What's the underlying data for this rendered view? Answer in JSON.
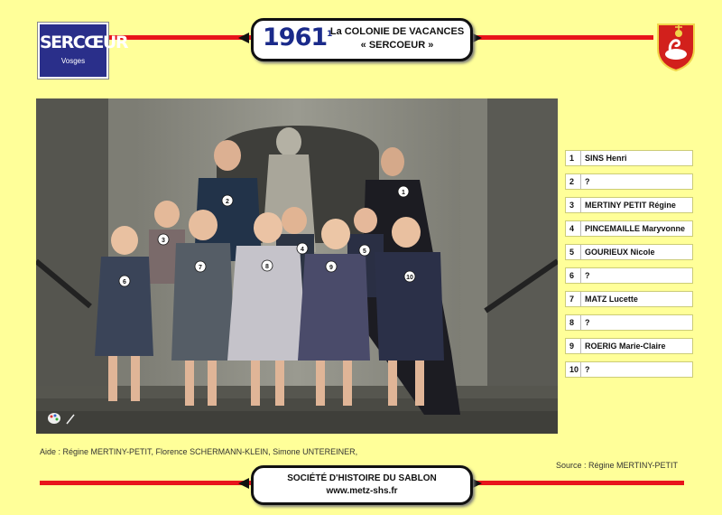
{
  "header": {
    "logo_text": "SERCŒUR",
    "logo_subtext": "Vosges",
    "year": "1961",
    "year_sup": "1",
    "title_line1": "La COLONIE DE VACANCES",
    "title_line2": "« SERCOEUR »"
  },
  "names": [
    {
      "num": "1",
      "name": "SINS Henri"
    },
    {
      "num": "2",
      "name": "?"
    },
    {
      "num": "3",
      "name": "MERTINY PETIT Régine"
    },
    {
      "num": "4",
      "name": "PINCEMAILLE Maryvonne"
    },
    {
      "num": "5",
      "name": "GOURIEUX Nicole"
    },
    {
      "num": "6",
      "name": "?"
    },
    {
      "num": "7",
      "name": "MATZ Lucette"
    },
    {
      "num": "8",
      "name": "?"
    },
    {
      "num": "9",
      "name": "ROERIG Marie-Claire"
    },
    {
      "num": "10",
      "name": "?"
    }
  ],
  "footer": {
    "aide": "Aide : Régine MERTINY-PETIT, Florence SCHERMANN-KLEIN, Simone UNTEREINER,",
    "source": "Source : Régine MERTINY-PETIT",
    "society": "SOCIÉTÉ D'HISTOIRE DU SABLON",
    "url": "www.metz-shs.fr"
  },
  "colors": {
    "background": "#ffff99",
    "rule": "#e8141b",
    "logo_bg": "#2a2f8a",
    "year": "#1a2a8a"
  }
}
